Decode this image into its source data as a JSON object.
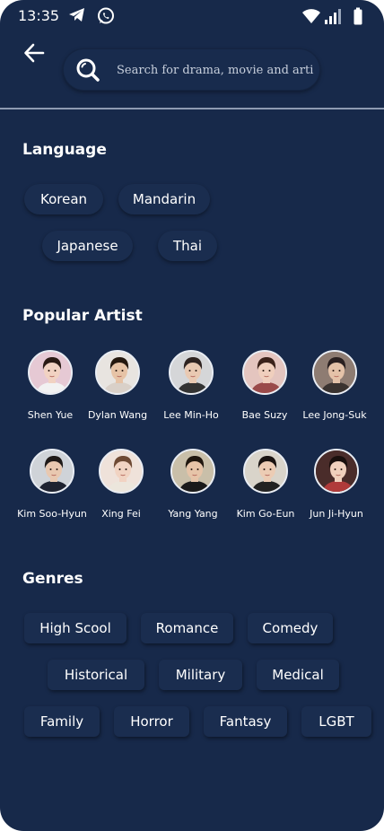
{
  "status_bar": {
    "time": "13:35",
    "app_icons": [
      "telegram-icon",
      "whatsapp-icon"
    ],
    "system_icons": [
      "wifi-icon",
      "signal-icon",
      "battery-icon"
    ]
  },
  "header": {
    "back_icon": "arrow-left-icon",
    "search": {
      "icon": "search-icon",
      "placeholder": "Search for drama, movie and artist",
      "value": ""
    }
  },
  "language": {
    "title": "Language",
    "items": [
      "Korean",
      "Mandarin",
      "Japanese",
      "Thai"
    ]
  },
  "artists": {
    "title": "Popular Artist",
    "items": [
      {
        "name": "Shen Yue",
        "bg": "#e6c9d4",
        "hair": "#2a1a14",
        "skin": "#f1d2c2",
        "cloth": "#f2f2f2"
      },
      {
        "name": "Dylan Wang",
        "bg": "#e8e4e0",
        "hair": "#24180f",
        "skin": "#e6c3a6",
        "cloth": "#d9d0c8"
      },
      {
        "name": "Lee Min-Ho",
        "bg": "#d5d6d8",
        "hair": "#2e2320",
        "skin": "#e9c9b2",
        "cloth": "#333333"
      },
      {
        "name": "Bae Suzy",
        "bg": "#e4c5bf",
        "hair": "#3b221a",
        "skin": "#f0cfbd",
        "cloth": "#9a4a4a"
      },
      {
        "name": "Lee Jong-Suk",
        "bg": "#8e7c72",
        "hair": "#2a2020",
        "skin": "#e4c2a8",
        "cloth": "#3a3330"
      },
      {
        "name": "Kim Soo-Hyun",
        "bg": "#cfd3d8",
        "hair": "#1f1a18",
        "skin": "#e8c8b0",
        "cloth": "#1e2230"
      },
      {
        "name": "Xing Fei",
        "bg": "#efe2da",
        "hair": "#6e4a34",
        "skin": "#f1d3c2",
        "cloth": "#ece6dc"
      },
      {
        "name": "Yang Yang",
        "bg": "#c9bfa9",
        "hair": "#20170f",
        "skin": "#e6c4a8",
        "cloth": "#1a1a1a"
      },
      {
        "name": "Kim Go-Eun",
        "bg": "#d9d4ca",
        "hair": "#1a1412",
        "skin": "#ecccb4",
        "cloth": "#222222"
      },
      {
        "name": "Jun Ji-Hyun",
        "bg": "#4a2c2a",
        "hair": "#1a0f0d",
        "skin": "#f0d0bd",
        "cloth": "#b03a3a"
      }
    ]
  },
  "genres": {
    "title": "Genres",
    "items": [
      "High Scool",
      "Romance",
      "Comedy",
      "Historical",
      "Military",
      "Medical",
      "Family",
      "Horror",
      "Fantasy",
      "LGBT"
    ]
  }
}
